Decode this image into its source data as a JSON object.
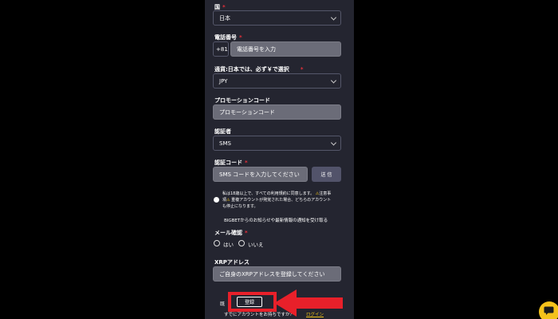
{
  "form": {
    "country": {
      "label": "国",
      "value": "日本"
    },
    "phone": {
      "label": "電話番号",
      "prefix": "+81",
      "placeholder": "電話番号を入力"
    },
    "currency": {
      "label": "通貨:日本では、必ず￥で選択",
      "value": "JPY"
    },
    "promo": {
      "label": "プロモーションコード",
      "placeholder": "プロモーションコード"
    },
    "verifier": {
      "label": "認証者",
      "value": "SMS"
    },
    "code": {
      "label": "認証コード",
      "placeholder": "SMS コードを入力してください",
      "send_label": "送 信"
    },
    "terms": {
      "line1": "私は18歳以上で、すべての利用規約に同意します。",
      "warn1": "注意事",
      "line2": "項",
      "line2b": "重複アカウントが発覚された場合、どちらのアカウント",
      "line3": "も停止になります。"
    },
    "newsletter": "BIGBETからのお知らせや最新情報の通知を受け取る",
    "email_consent": {
      "label": "メール確認",
      "yes": "はい",
      "no": "いいえ"
    },
    "xrp": {
      "label": "XRPアドレス",
      "placeholder": "ご自身のXRPアドレスを登録してください"
    },
    "register_label": "登録",
    "footer_left": "既",
    "footer_text": "すでにアカウントをお持ちですか？",
    "login_link": "ログイン"
  },
  "colors": {
    "panel": "#242530",
    "accent_red": "#e8303a",
    "link": "#f0c419",
    "chat": "#f5c21b"
  },
  "icons": {
    "chevron": "chevron-down-icon",
    "warning": "warning-icon",
    "arrow": "red-arrow-left-icon",
    "chat": "chat-icon"
  }
}
